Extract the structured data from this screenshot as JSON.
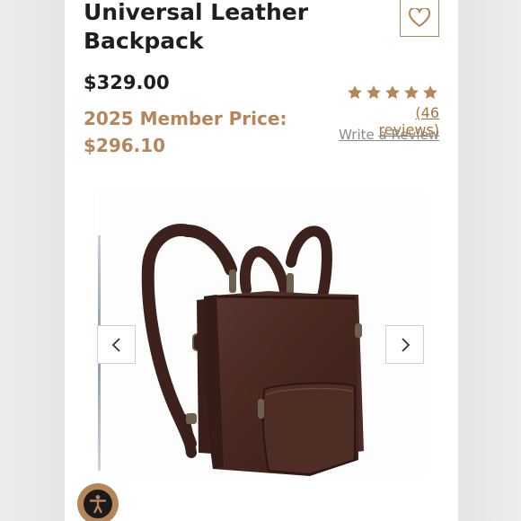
{
  "product": {
    "title": "Universal Leather Backpack",
    "price": "$329.00",
    "member_price": "2025 Member Price: $296.10"
  },
  "rating": {
    "stars": 5,
    "reviews_link": "(46 reviews)",
    "write_review_link": "Write a Review"
  },
  "icons": {
    "favorite": "heart-icon",
    "prev": "chevron-left-icon",
    "next": "chevron-right-icon",
    "star": "star-icon",
    "accessibility": "accessibility-icon"
  },
  "colors": {
    "accent": "#b5865a",
    "text": "#1f1f1f",
    "leather": "#4a2a25"
  }
}
